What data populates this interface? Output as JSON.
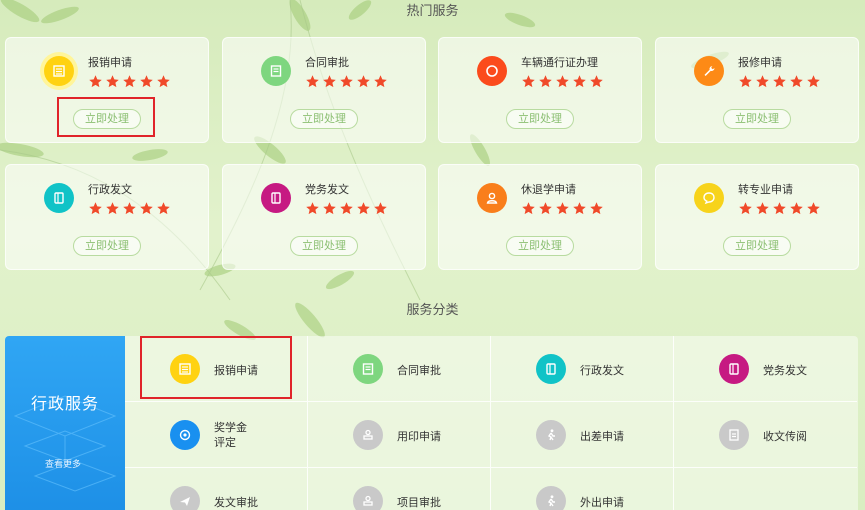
{
  "hot_services": {
    "title": "热门服务",
    "button_label": "立即处理",
    "items": [
      {
        "name": "报销申请",
        "icon": "receipt-icon",
        "color": "#ffd211",
        "rating": 5
      },
      {
        "name": "合同审批",
        "icon": "contract-icon",
        "color": "#7ed67f",
        "rating": 5
      },
      {
        "name": "车辆通行证办理",
        "icon": "circle-icon",
        "color": "#fb4b1c",
        "rating": 5
      },
      {
        "name": "报修申请",
        "icon": "wrench-icon",
        "color": "#fd8a16",
        "rating": 5
      },
      {
        "name": "行政发文",
        "icon": "document-icon",
        "color": "#10c3c7",
        "rating": 5
      },
      {
        "name": "党务发文",
        "icon": "document-icon",
        "color": "#c61a82",
        "rating": 5
      },
      {
        "name": "休退学申请",
        "icon": "user-icon",
        "color": "#f97e1b",
        "rating": 5
      },
      {
        "name": "转专业申请",
        "icon": "chat-bubble-icon",
        "color": "#f7d31b",
        "rating": 5
      }
    ]
  },
  "categories": {
    "title": "服务分类",
    "active": {
      "name": "行政服务",
      "more": "查看更多",
      "color": "#2a9ff0"
    },
    "items": [
      {
        "name": "报销申请",
        "icon": "receipt-icon",
        "color": "#ffd211"
      },
      {
        "name": "合同审批",
        "icon": "contract-icon",
        "color": "#7ed67f"
      },
      {
        "name": "行政发文",
        "icon": "document-icon",
        "color": "#10c3c7"
      },
      {
        "name": "党务发文",
        "icon": "document-icon",
        "color": "#c61a82"
      },
      {
        "name": "奖学金评定",
        "icon": "award-icon",
        "color": "#1990f0"
      },
      {
        "name": "用印申请",
        "icon": "stamp-icon",
        "color": "#c9c9c9"
      },
      {
        "name": "出差申请",
        "icon": "walker-icon",
        "color": "#c9c9c9"
      },
      {
        "name": "收文传阅",
        "icon": "inbox-icon",
        "color": "#c9c9c9"
      },
      {
        "name": "发文审批",
        "icon": "plane-icon",
        "color": "#c9c9c9"
      },
      {
        "name": "项目审批",
        "icon": "stamp-icon",
        "color": "#c9c9c9"
      },
      {
        "name": "外出申请",
        "icon": "walker-icon",
        "color": "#c9c9c9"
      }
    ]
  },
  "theme": {
    "star_color": "#f04a2a",
    "highlight_color": "#e0242a",
    "button_color": "#8bbf72"
  }
}
